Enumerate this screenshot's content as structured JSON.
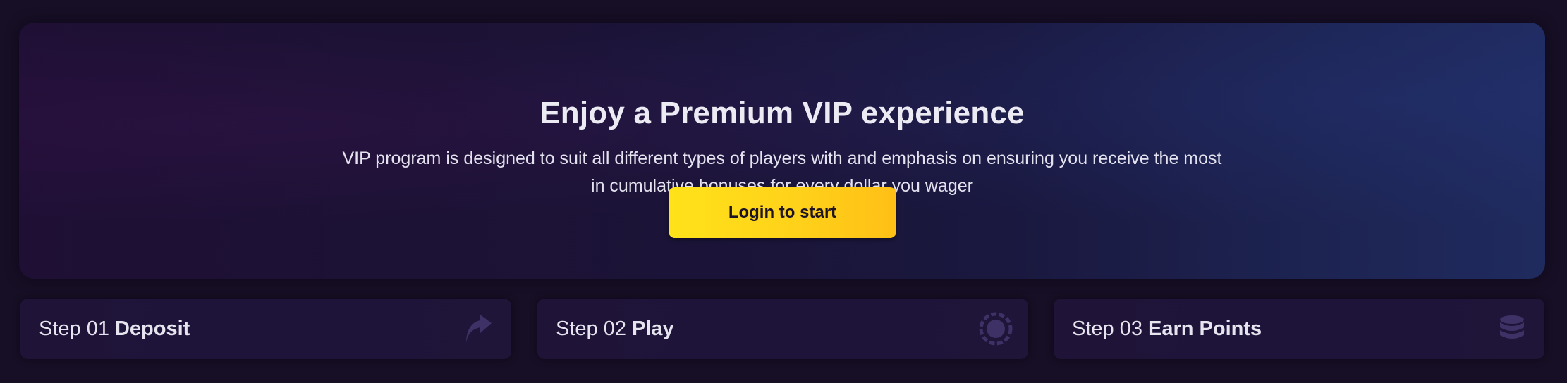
{
  "hero": {
    "title": "Enjoy a Premium VIP experience",
    "description_line1": "VIP program is designed to suit all different types of players with and emphasis on ensuring you receive the most",
    "description_line2": "in cumulative bonuses for every dollar you wager",
    "cta_label": "Login to start"
  },
  "steps": [
    {
      "number": "Step 01",
      "name": "Deposit",
      "icon": "arrow-up-icon"
    },
    {
      "number": "Step 02",
      "name": "Play",
      "icon": "poker-chip-icon"
    },
    {
      "number": "Step 03",
      "name": "Earn Points",
      "icon": "coin-stack-icon"
    }
  ],
  "colors": {
    "background": "#170f25",
    "cta_yellow": "#ffd21a",
    "text_primary": "#ecebf4",
    "icon_muted": "#3e3166"
  }
}
